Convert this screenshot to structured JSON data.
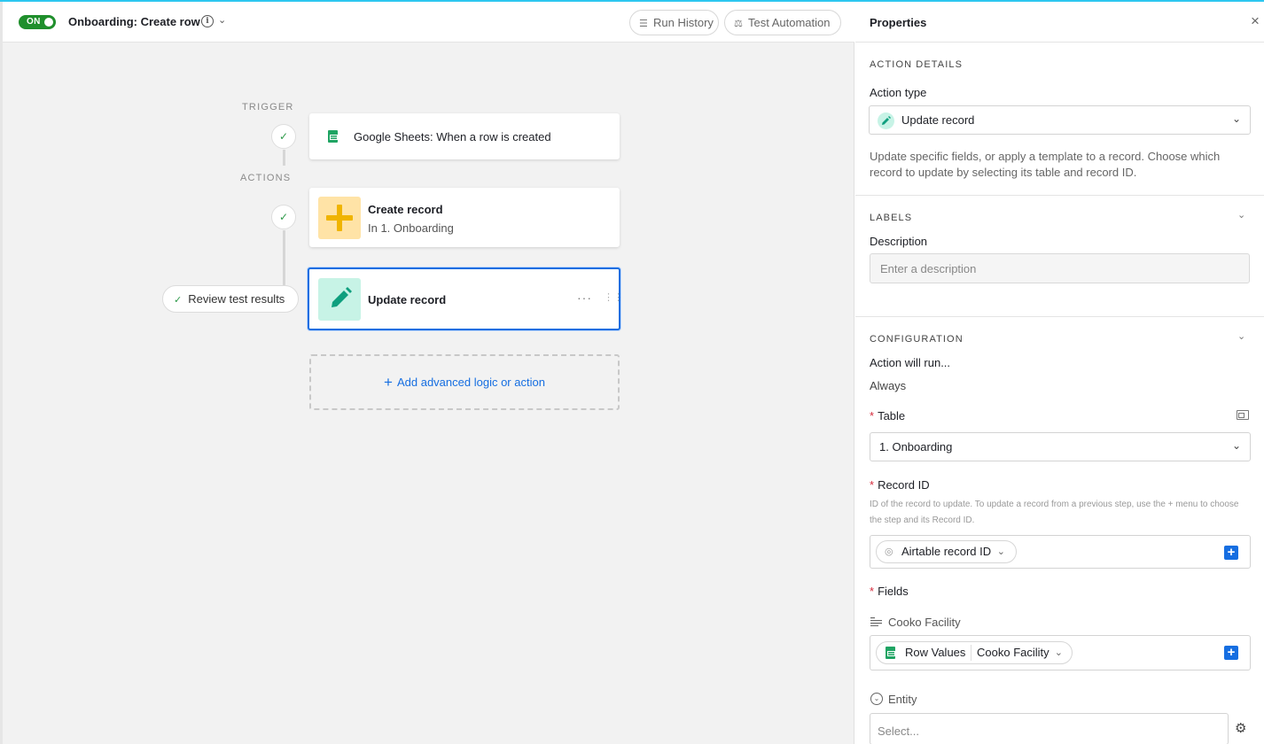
{
  "topbar": {
    "toggle_label": "ON",
    "automation_title": "Onboarding: Create row",
    "run_history_label": "Run History",
    "test_automation_label": "Test Automation"
  },
  "canvas": {
    "trigger_label": "TRIGGER",
    "actions_label": "ACTIONS",
    "trigger_card_title": "Google Sheets: When a row is created",
    "create_card_title": "Create record",
    "create_card_subtitle": "In 1. Onboarding",
    "update_card_title": "Update record",
    "update_card_more": "···",
    "review_label": "Review test results",
    "add_action_label": "Add advanced logic or action"
  },
  "panel": {
    "title": "Properties",
    "action_details": {
      "section_label": "ACTION DETAILS",
      "action_type_label": "Action type",
      "action_type_value": "Update record",
      "help": "Update specific fields, or apply a template to a record. Choose which record to update by selecting its table and record ID."
    },
    "labels": {
      "section_label": "LABELS",
      "description_label": "Description",
      "description_placeholder": "Enter a description"
    },
    "configuration": {
      "section_label": "CONFIGURATION",
      "run_label": "Action will run...",
      "run_value": "Always",
      "table_label": "Table",
      "table_value": "1. Onboarding",
      "record_id_label": "Record ID",
      "record_id_help": "ID of the record to update. To update a record from a previous step, use the + menu to choose the step and its Record ID.",
      "record_id_token": "Airtable record ID",
      "fields_label": "Fields",
      "field1_name": "Cooko Facility",
      "field1_token_source": "Row Values",
      "field1_token_value": "Cooko Facility",
      "field2_name": "Entity",
      "field2_placeholder": "Select..."
    }
  },
  "colors": {
    "accent_blue": "#166ee1",
    "toggle_green": "#1f8f2c",
    "check_green": "#2e9a4a",
    "required_red": "#d52b3c",
    "top_line": "#2dc7f0"
  }
}
